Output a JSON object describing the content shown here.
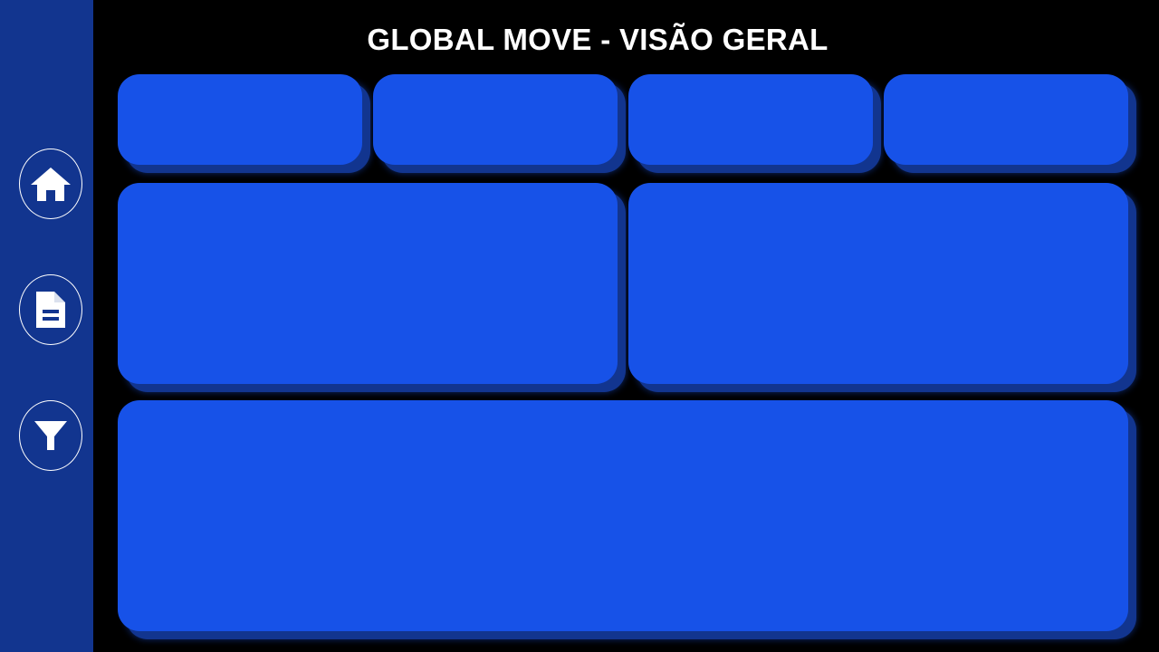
{
  "header": {
    "title": "GLOBAL MOVE - VISÃO GERAL"
  },
  "sidebar": {
    "items": [
      {
        "icon": "home-icon"
      },
      {
        "icon": "document-icon"
      },
      {
        "icon": "filter-icon"
      }
    ]
  },
  "colors": {
    "background": "#000000",
    "sidebar": "#12358f",
    "card": "#1752e8",
    "card_shadow": "#12358f",
    "text": "#ffffff"
  }
}
